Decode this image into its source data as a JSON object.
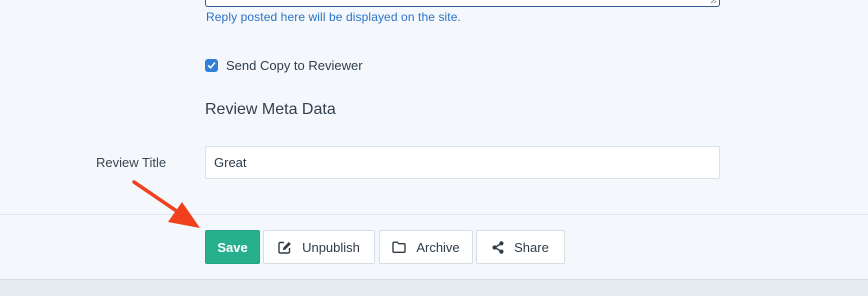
{
  "reply": {
    "help_text": "Reply posted here will be displayed on the site."
  },
  "send_copy": {
    "label": "Send Copy to Reviewer",
    "checked": true
  },
  "meta_section": {
    "title": "Review Meta Data"
  },
  "review_title": {
    "label": "Review Title",
    "value": "Great"
  },
  "actions": {
    "save": "Save",
    "unpublish": "Unpublish",
    "archive": "Archive",
    "share": "Share"
  },
  "colors": {
    "save_button": "#26b08e",
    "checkbox": "#2f80d6",
    "help_text": "#2a73c8",
    "annotation_arrow": "#f0401e"
  },
  "icons": {
    "unpublish": "edit-icon",
    "archive": "folder-icon",
    "share": "share-icon"
  }
}
